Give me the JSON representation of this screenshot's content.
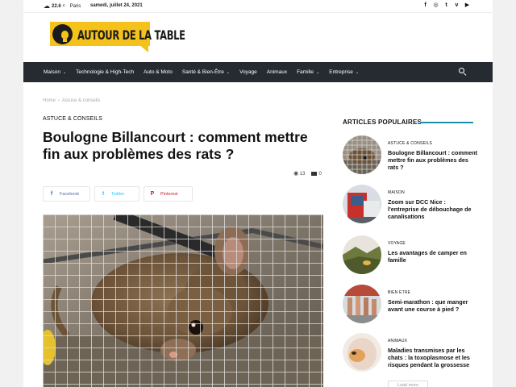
{
  "topbar": {
    "weather_icon": "cloud-sun-icon",
    "temperature": "22.6",
    "degree_symbol": "C",
    "city": "Paris",
    "date": "samedi, juillet 24, 2021",
    "socials": [
      "facebook-icon",
      "instagram-icon",
      "twitter-icon",
      "vimeo-icon",
      "youtube-icon"
    ]
  },
  "logo": {
    "text": "AUTOUR DE LA TABLE"
  },
  "nav": {
    "items": [
      {
        "label": "Maison",
        "has_dropdown": true
      },
      {
        "label": "Technologie & High-Tech",
        "has_dropdown": false
      },
      {
        "label": "Auto & Moto",
        "has_dropdown": false
      },
      {
        "label": "Santé & Bien-Être",
        "has_dropdown": true
      },
      {
        "label": "Voyage",
        "has_dropdown": false
      },
      {
        "label": "Animaux",
        "has_dropdown": false
      },
      {
        "label": "Famille",
        "has_dropdown": true
      },
      {
        "label": "Entreprise",
        "has_dropdown": true
      }
    ],
    "chevron": "⌄"
  },
  "breadcrumb": {
    "home": "Home",
    "separator": "›",
    "current": "Astuce & conseils"
  },
  "article": {
    "category": "ASTUCE & CONSEILS",
    "title": "Boulogne Billancourt : comment mettre fin aux problèmes des rats ?",
    "views": "13",
    "comments": "0",
    "share": {
      "facebook": "Facebook",
      "twitter": "Twitter",
      "pinterest": "Pinterest"
    }
  },
  "sidebar": {
    "title": "ARTICLES POPULAIRES",
    "accent_color": "#1c8ea8",
    "items": [
      {
        "category": "ASTUCE & CONSEILS",
        "title": "Boulogne Billancourt : comment mettre fin aux problèmes des rats ?"
      },
      {
        "category": "MAISON",
        "title": "Zoom sur DCC Nice : l'entreprise de débouchage de canalisations"
      },
      {
        "category": "VOYAGE",
        "title": "Les avantages de camper en famille"
      },
      {
        "category": "BIEN ETRE",
        "title": "Semi-marathon : que manger avant une course à pied ?"
      },
      {
        "category": "ANIMAUX",
        "title": "Maladies transmises par les chats : la toxoplasmose et les risques pendant la grossesse"
      }
    ],
    "load_more": "Load more"
  },
  "colors": {
    "nav_bg": "#262b31",
    "logo_yellow": "#f4c21a",
    "facebook": "#516eab",
    "twitter": "#29c5f6",
    "pinterest": "#ca212a"
  }
}
